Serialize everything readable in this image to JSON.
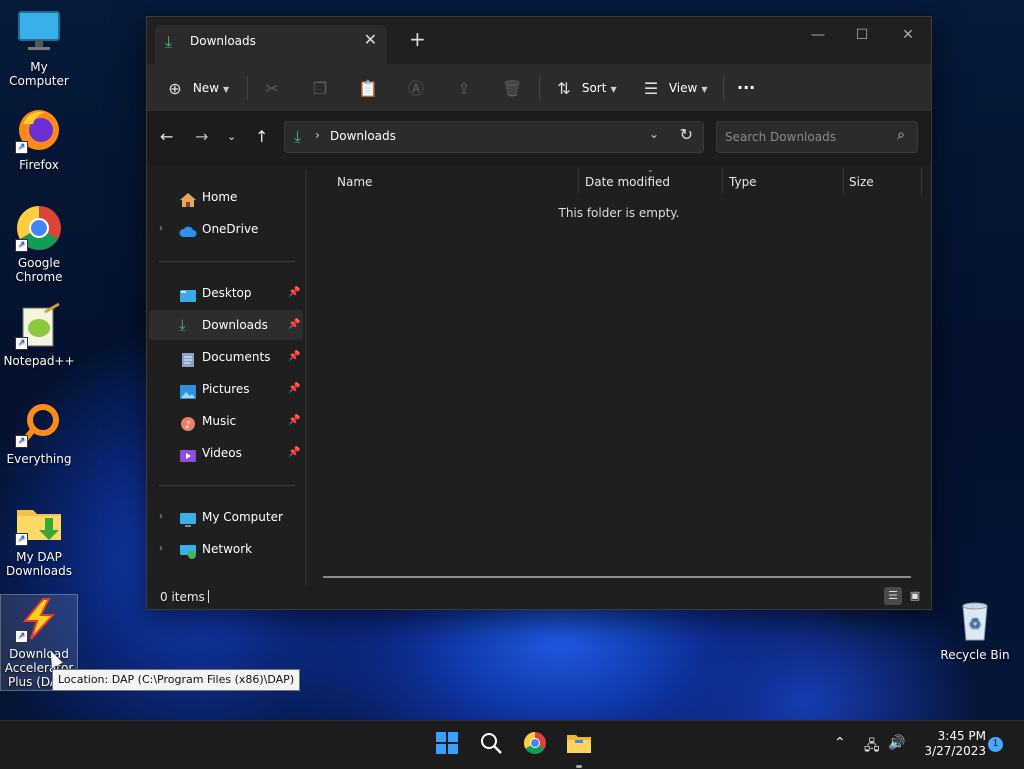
{
  "desktop": {
    "icons": [
      {
        "label": "My Computer"
      },
      {
        "label": "Firefox"
      },
      {
        "label": "Google Chrome"
      },
      {
        "label": "Notepad++"
      },
      {
        "label": "Everything"
      },
      {
        "label": "My DAP Downloads"
      },
      {
        "label": "Download Accelerator Plus (DAP)"
      }
    ],
    "recycle_bin": {
      "label": "Recycle Bin"
    },
    "tooltip": "Location: DAP (C:\\Program Files (x86)\\DAP)"
  },
  "explorer": {
    "tab_title": "Downloads",
    "toolbar": {
      "new_label": "New",
      "sort_label": "Sort",
      "view_label": "View",
      "more_label": "···"
    },
    "address": {
      "path": "Downloads",
      "search_placeholder": "Search Downloads"
    },
    "nav": {
      "home": "Home",
      "onedrive": "OneDrive",
      "desktop": "Desktop",
      "downloads": "Downloads",
      "documents": "Documents",
      "pictures": "Pictures",
      "music": "Music",
      "videos": "Videos",
      "mycomputer": "My Computer",
      "network": "Network"
    },
    "columns": [
      "Name",
      "Date modified",
      "Type",
      "Size"
    ],
    "empty_message": "This folder is empty.",
    "status": "0 items"
  },
  "taskbar": {
    "time": "3:45 PM",
    "date": "3/27/2023",
    "notifications": "1"
  },
  "colors": {
    "accent_green": "#3fbf6f",
    "window_bg": "#1f1f1f",
    "taskbar_bg": "#1c1c1c"
  }
}
